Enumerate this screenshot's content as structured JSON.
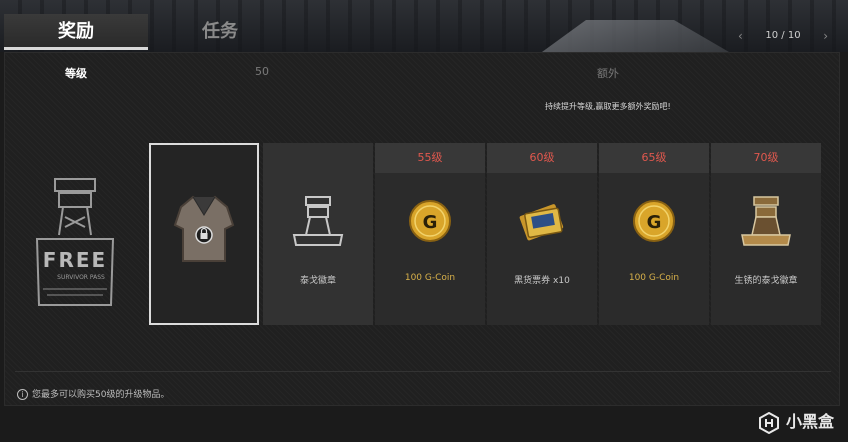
{
  "tabs": {
    "active": "奖励",
    "inactive": "任务"
  },
  "pager": {
    "count": "10 / 10",
    "left": "‹",
    "right": "›"
  },
  "headers": {
    "level": "等级",
    "fifty": "50",
    "extra": "额外"
  },
  "hint": "持续提升等级,赢取更多额外奖励吧!",
  "free_badge": {
    "label": "FREE",
    "sub": "SURVIVOR PASS"
  },
  "cards": [
    {
      "level": "",
      "name": "泰戈徽章",
      "gold": false,
      "icon": "tower-emblem-icon"
    },
    {
      "level": "55级",
      "name": "100 G-Coin",
      "gold": true,
      "icon": "g-coin-icon"
    },
    {
      "level": "60级",
      "name": "黑货票券 x10",
      "gold": false,
      "icon": "ticket-icon"
    },
    {
      "level": "65级",
      "name": "100 G-Coin",
      "gold": true,
      "icon": "g-coin-icon"
    },
    {
      "level": "70级",
      "name": "生锈的泰戈徽章",
      "gold": false,
      "icon": "rusty-tower-emblem-icon"
    }
  ],
  "selected": {
    "icon": "shirt-icon",
    "lock": "lock-icon"
  },
  "footnote": "您最多可以购买50级的升级物品。",
  "watermark": "小黑盒"
}
